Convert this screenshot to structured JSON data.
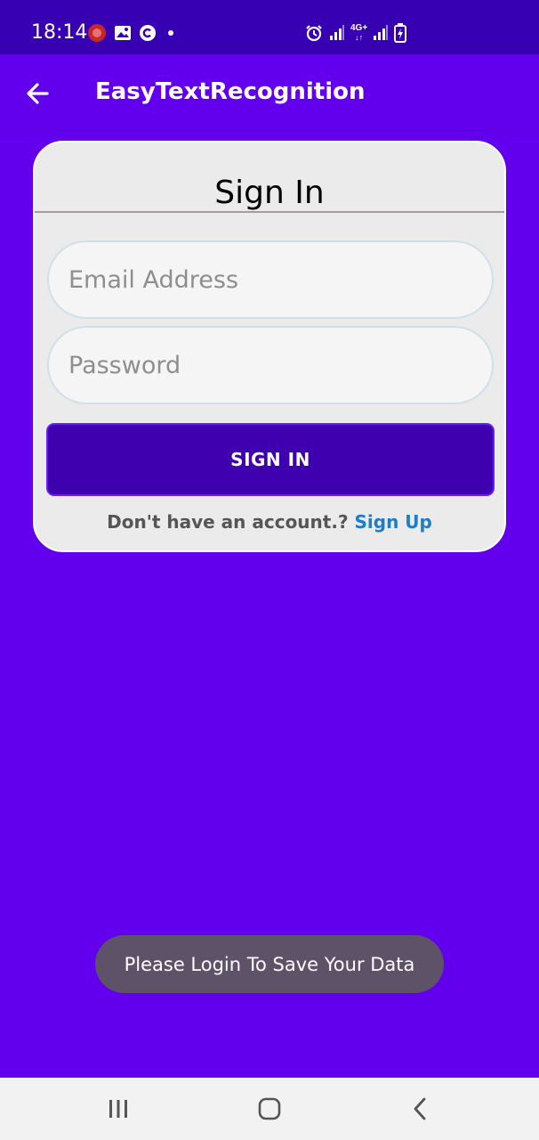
{
  "status_bar": {
    "time": "18:14",
    "left_icons": [
      "app-notification-icon",
      "image-icon",
      "c-circle-icon",
      "dot-icon"
    ],
    "right_icons": [
      "alarm-icon",
      "signal-icon",
      "network-4g-icon",
      "signal-icon",
      "battery-charging-icon"
    ],
    "network_label": "4G+"
  },
  "app_bar": {
    "title": "EasyTextRecognition",
    "back_icon": "arrow-left-icon"
  },
  "card": {
    "title": "Sign In",
    "email_placeholder": "Email Address",
    "email_value": "",
    "password_placeholder": "Password",
    "password_value": "",
    "sign_in_label": "SIGN IN",
    "no_account_text": "Don't have an account.? ",
    "sign_up_label": "Sign Up"
  },
  "toast": {
    "message": "Please Login To Save Your Data"
  },
  "nav_bar": {
    "icons": [
      "recents-icon",
      "home-icon",
      "back-icon"
    ]
  },
  "colors": {
    "primary": "#6200EE",
    "primary_dark": "#3700B3",
    "button": "#3F00B0",
    "link": "#1E7DC6",
    "card_bg": "#EBEBEB",
    "toast_bg": "#5E5269"
  }
}
